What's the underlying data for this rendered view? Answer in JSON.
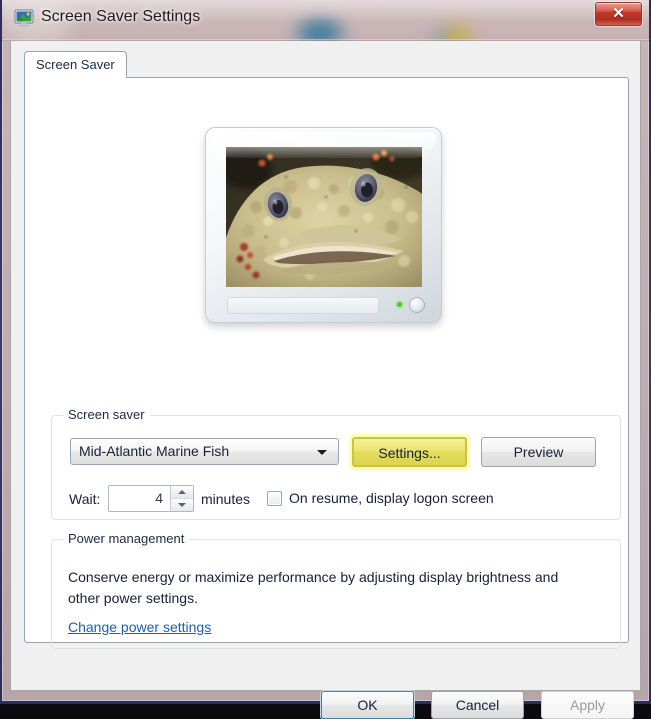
{
  "window": {
    "title": "Screen Saver Settings",
    "icon": "display-monitor-icon",
    "close_label": "✕"
  },
  "tabs": [
    {
      "label": "Screen Saver",
      "selected": true
    }
  ],
  "preview": {
    "monitor_name": "screen-saver-preview-monitor",
    "image_description": "Mid-Atlantic marine fish close-up (oyster toadfish)",
    "led_color": "#49d21a"
  },
  "screen_saver_group": {
    "title": "Screen saver",
    "dropdown": {
      "selected": "Mid-Atlantic Marine Fish",
      "options": [
        "Mid-Atlantic Marine Fish"
      ]
    },
    "settings_button": "Settings...",
    "preview_button": "Preview",
    "wait_label": "Wait:",
    "wait_value": "4",
    "minutes_label": "minutes",
    "on_resume_label": "On resume, display logon screen",
    "on_resume_checked": false,
    "highlight_color": "#e4dc5c"
  },
  "power_group": {
    "title": "Power management",
    "description": "Conserve energy or maximize performance by adjusting display brightness and other power settings.",
    "link": "Change power settings"
  },
  "dialog_buttons": {
    "ok": "OK",
    "cancel": "Cancel",
    "apply": "Apply",
    "apply_enabled": false
  }
}
